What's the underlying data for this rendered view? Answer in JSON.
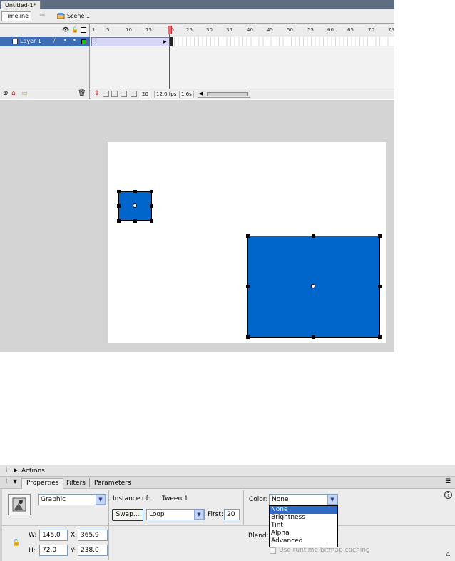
{
  "document": {
    "tab_title": "Untitled-1*"
  },
  "editbar": {
    "timeline_button": "Timeline",
    "scene_label": "Scene 1"
  },
  "timeline": {
    "layer_name": "Layer 1",
    "ruler_numbers": [
      "1",
      "5",
      "10",
      "15",
      "20",
      "25",
      "30",
      "35",
      "40",
      "45",
      "50",
      "55",
      "60",
      "65",
      "70",
      "75"
    ],
    "current_frame": "20",
    "frame_rate": "12.0 fps",
    "elapsed_time": "1.6s"
  },
  "properties": {
    "actions_label": "Actions",
    "tabs": [
      "Properties",
      "Filters",
      "Parameters"
    ],
    "behavior": "Graphic",
    "instance_of_label": "Instance of:",
    "instance_name": "Tween 1",
    "swap_button": "Swap...",
    "loop_value": "Loop",
    "first_label": "First:",
    "first_value": "20",
    "color_label": "Color:",
    "color_value": "None",
    "color_options": [
      "None",
      "Brightness",
      "Tint",
      "Alpha",
      "Advanced"
    ],
    "blend_label": "Blend:",
    "cache_label": "Use runtime bitmap caching",
    "w_label": "W:",
    "w_value": "145.0",
    "h_label": "H:",
    "h_value": "72.0",
    "x_label": "X:",
    "x_value": "365.9",
    "y_label": "Y:",
    "y_value": "238.0"
  },
  "colors": {
    "shape_fill": "#0066cc",
    "layer_selected": "#3d6db5",
    "tween_span": "#d7d6f6"
  }
}
